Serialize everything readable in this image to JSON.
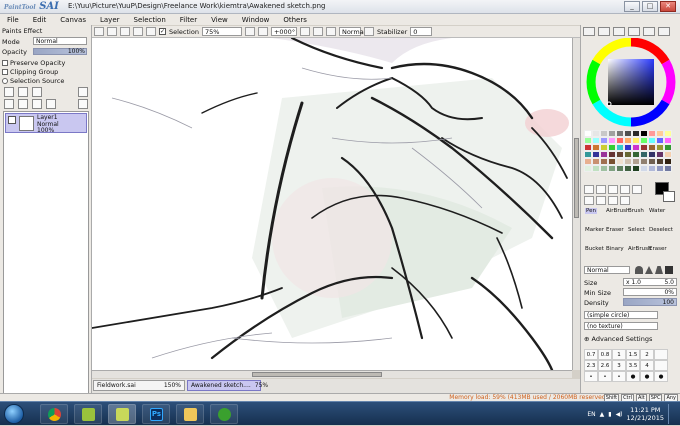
{
  "app": {
    "logo_main": "SAI",
    "logo_sub": "PaintTool",
    "title_path": "E:\\Yuu\\Picture\\YuuP\\Design\\Freelance Work\\kiemtra\\Awakened sketch.png",
    "window_buttons": [
      "_",
      "□",
      "✕"
    ]
  },
  "menu": [
    "File",
    "Edit",
    "Canvas",
    "Layer",
    "Selection",
    "Filter",
    "View",
    "Window",
    "Others"
  ],
  "toolbar": {
    "selection_label": "Selection",
    "zoom": "75%",
    "rotation": "+000°",
    "blend_mode": "Normal",
    "stabilizer_label": "Stabilizer",
    "stabilizer_value": "0"
  },
  "layer_panel": {
    "title": "Paints Effect",
    "mode_label": "Mode",
    "mode_value": "Normal",
    "opacity_label": "Opacity",
    "opacity_value": "100%",
    "checkboxes": [
      "Preserve Opacity",
      "Clipping Group",
      "Selection Source"
    ],
    "layers": [
      {
        "name": "Layer1",
        "mode": "Normal",
        "opacity": "100%"
      }
    ]
  },
  "file_tabs": [
    {
      "name": "Fieldwork.sai",
      "zoom": "150%",
      "active": false
    },
    {
      "name": "Awakened sketch....",
      "zoom": "75%",
      "active": true
    }
  ],
  "colors": {
    "current": "#000000",
    "accent_selection": "#c9c7f0",
    "palette": [
      "#ffffff",
      "#e6e6e6",
      "#c8c8c8",
      "#a0a0a0",
      "#787878",
      "#505050",
      "#282828",
      "#000000",
      "#ff9999",
      "#ffcc99",
      "#ffff99",
      "#99ff99",
      "#99ffff",
      "#9999ff",
      "#ff99ff",
      "#ff6666",
      "#ffaa66",
      "#ffee66",
      "#66ff66",
      "#66ffff",
      "#6666ff",
      "#ff66ff",
      "#cc3333",
      "#cc7733",
      "#cccc33",
      "#33cc33",
      "#33cccc",
      "#3333cc",
      "#cc33cc",
      "#993333",
      "#996633",
      "#999933",
      "#339933",
      "#339999",
      "#333399",
      "#993399",
      "#663333",
      "#664433",
      "#666633",
      "#336633",
      "#336666",
      "#333366",
      "#663366",
      "#f5d0b0",
      "#e8b090",
      "#c89070",
      "#a07050",
      "#785030",
      "#f0e0d0",
      "#d0c0b0",
      "#b0a090",
      "#908070",
      "#706050",
      "#504030",
      "#302010",
      "#e0f0e0",
      "#c0e0c0",
      "#a0c0a0",
      "#80a080",
      "#608060",
      "#406040",
      "#204020",
      "#d0d8e8",
      "#b0b8d8",
      "#9098c0",
      "#7078a0"
    ]
  },
  "tools": {
    "row1": [
      "Pen",
      "AirBrush",
      "Brush",
      "Water"
    ],
    "row2": [
      "Marker",
      "Eraser",
      "Select",
      "Deselect"
    ],
    "row3": [
      "Bucket",
      "Binary",
      "AirBrush",
      "Eraser"
    ]
  },
  "brush": {
    "blend": "Normal",
    "size_label": "Size",
    "size_mult": "x 1.0",
    "size_value": "5.0",
    "min_size_label": "Min Size",
    "min_size_value": "0%",
    "density_label": "Density",
    "density_value": "100",
    "shape": "(simple circle)",
    "texture": "(no texture)",
    "advanced": "Advanced Settings",
    "size_presets": [
      "0.7",
      "0.8",
      "1",
      "1.5",
      "2",
      "2.3",
      "2.6",
      "3",
      "3.5",
      "4"
    ]
  },
  "status": {
    "memory": "Memory load: 59% (413MB used / 2060MB reserved)",
    "mod_keys": [
      "Shift",
      "Ctrl",
      "Alt",
      "SPC",
      "Any"
    ]
  },
  "taskbar": {
    "apps": [
      "chrome-icon",
      "sai-icon",
      "sai-active-icon",
      "photoshop-icon",
      "folder-icon",
      "utorrent-icon"
    ],
    "lang": "EN",
    "time": "11:21 PM",
    "date": "12/21/2015"
  }
}
